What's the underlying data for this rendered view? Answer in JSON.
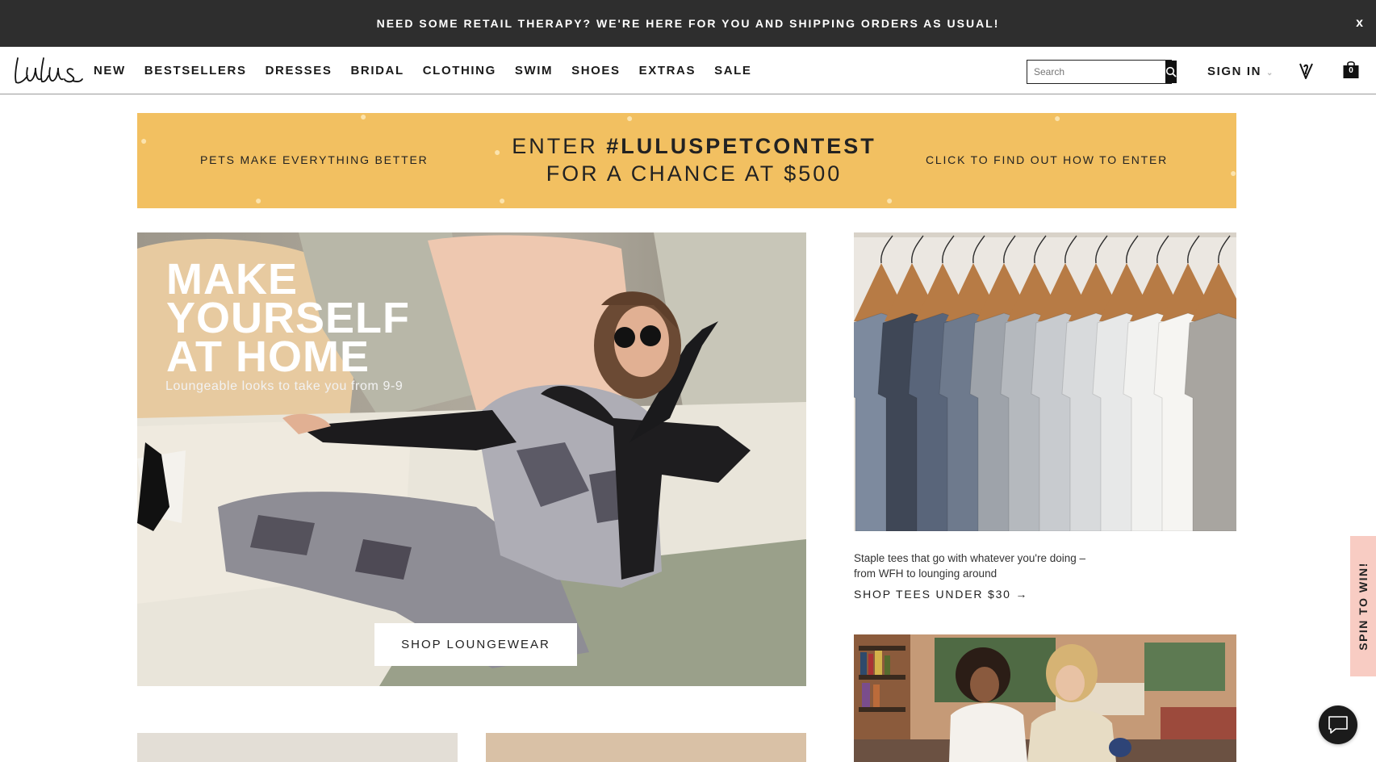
{
  "promo": {
    "text": "NEED SOME RETAIL THERAPY? WE'RE HERE FOR YOU AND SHIPPING ORDERS AS USUAL!",
    "close": "x"
  },
  "nav": {
    "items": [
      "NEW",
      "BESTSELLERS",
      "DRESSES",
      "BRIDAL",
      "CLOTHING",
      "SWIM",
      "SHOES",
      "EXTRAS",
      "SALE"
    ],
    "search_placeholder": "Search",
    "sign_in": "SIGN IN",
    "bag_count": "0"
  },
  "banner": {
    "left": "PETS MAKE EVERYTHING BETTER",
    "center_line1_prefix": "ENTER ",
    "center_line1_tag": "#LULUSPETCONTEST",
    "center_line2": "FOR A CHANCE AT $500",
    "right": "CLICK TO FIND OUT HOW TO ENTER"
  },
  "hero": {
    "title_line1": "MAKE",
    "title_line2": "YOURSELF",
    "title_line3": "AT HOME",
    "subtitle": "Loungeable looks to take you from 9-9",
    "button": "SHOP LOUNGEWEAR"
  },
  "tees": {
    "desc_line1": "Staple tees that go with whatever you're doing –",
    "desc_line2": "from WFH to lounging around",
    "link": "SHOP TEES UNDER $30 →"
  },
  "spin": {
    "label": "SPIN TO WIN!"
  },
  "colors": {
    "promo_bg": "#2e2e2e",
    "banner_bg": "#f2c061",
    "spin_bg": "#f8ccc3"
  },
  "icons": [
    "search-icon",
    "heart-icon",
    "bag-icon",
    "chat-icon",
    "chevron-down-icon",
    "close-icon"
  ]
}
